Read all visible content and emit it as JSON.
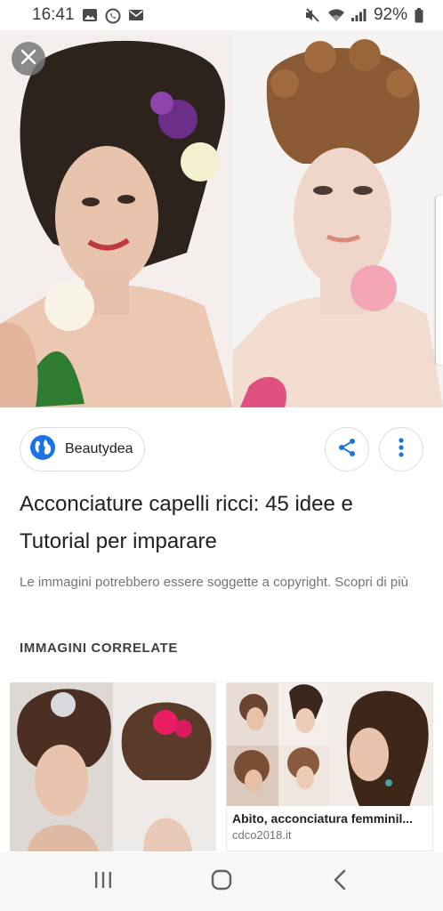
{
  "status_bar": {
    "time": "16:41",
    "battery": "92%",
    "left_icons": [
      "gallery-icon",
      "whatsapp-icon",
      "mail-icon"
    ],
    "right_icons": [
      "mute-icon",
      "wifi-icon",
      "signal-icon",
      "battery-icon"
    ]
  },
  "viewer": {
    "close_icon": "close-icon",
    "source": {
      "name": "Beautydea",
      "icon": "globe-icon"
    },
    "share_icon": "share-icon",
    "more_icon": "more-vert-icon",
    "title": "Acconciature capelli ricci: 45 idee e Tutorial per imparare",
    "copyright_text": "Le immagini potrebbero essere soggette a copyright. Scopri di più"
  },
  "related": {
    "heading": "IMMAGINI CORRELATE",
    "items": [
      {
        "title": "",
        "source": ""
      },
      {
        "title": "Abito, acconciatura femminil...",
        "source": "cdco2018.it"
      }
    ]
  },
  "nav_bar": {
    "icons": [
      "recents-icon",
      "home-icon",
      "back-icon"
    ]
  },
  "colors": {
    "accent_blue": "#1a73e8",
    "text_primary": "#202124",
    "text_secondary": "#70757a",
    "border": "#dadce0"
  }
}
